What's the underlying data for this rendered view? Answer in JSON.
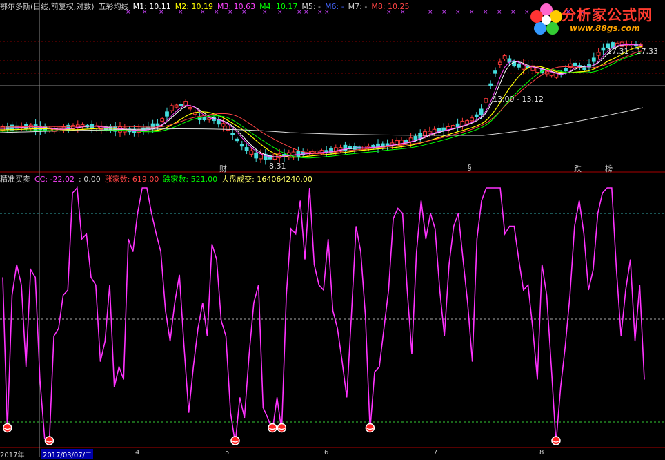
{
  "header": {
    "title": "鄂尔多斯(日线,前复权,对数)",
    "indicator": "五彩均线",
    "ma": [
      {
        "label": "M1: 10.11",
        "color": "#ffffff"
      },
      {
        "label": "M2: 10.19",
        "color": "#ffff00"
      },
      {
        "label": "M3: 10.63",
        "color": "#ff44ff"
      },
      {
        "label": "M4: 10.17",
        "color": "#00ff00"
      },
      {
        "label": "M5: -",
        "color": "#cccccc"
      },
      {
        "label": "M6: -",
        "color": "#4466ff"
      },
      {
        "label": "M7: -",
        "color": "#cccccc"
      },
      {
        "label": "M8: 10.25",
        "color": "#ff4444"
      }
    ]
  },
  "logo": {
    "title": "分析家公式网",
    "url": "www.88gs.com"
  },
  "price_labels": {
    "high": "17.31 - 17.33",
    "mid": "13.00 - 13.12",
    "low": "8.31"
  },
  "events": [
    {
      "text": "财",
      "color": "#66aaff"
    },
    {
      "text": "§",
      "color": "#ff3333"
    },
    {
      "text": "跌",
      "color": "#00ff00"
    },
    {
      "text": "榜",
      "color": "#ffaa00"
    }
  ],
  "sub_header": {
    "name": "精准买卖",
    "cc": "CC: -22.02",
    "zero": ": 0.00",
    "up": "涨家数: 619.00",
    "down": "跌家数: 521.00",
    "vol": "大盘成交: 164064240.00"
  },
  "axis": {
    "start": "2017年",
    "date": "2017/03/07/二",
    "months": [
      "4",
      "5",
      "6",
      "7",
      "8"
    ]
  },
  "chart_data": [
    {
      "type": "line",
      "title": "鄂尔多斯(日线,前复权,对数)",
      "series": [
        {
          "name": "M1",
          "color": "#ffffff"
        },
        {
          "name": "M2",
          "color": "#ffff00"
        },
        {
          "name": "M3",
          "color": "#ff44ff"
        },
        {
          "name": "M4",
          "color": "#00ff00"
        },
        {
          "name": "M8",
          "color": "#ff4444"
        }
      ],
      "annotations": [
        "17.31 - 17.33",
        "13.00 - 13.12",
        "8.31"
      ]
    },
    {
      "type": "line",
      "title": "精准买卖",
      "series": [
        {
          "name": "CC",
          "color": "#ff33ff",
          "values": [
            65,
            5,
            58,
            70,
            62,
            30,
            68,
            65,
            25,
            2,
            0,
            42,
            45,
            58,
            60,
            98,
            100,
            80,
            82,
            65,
            62,
            32,
            40,
            62,
            22,
            30,
            25,
            80,
            75,
            90,
            100,
            100,
            90,
            82,
            75,
            52,
            40,
            55,
            66,
            38,
            12,
            30,
            45,
            55,
            42,
            78,
            72,
            48,
            42,
            12,
            0,
            18,
            10,
            35,
            55,
            62,
            14,
            10,
            5,
            18,
            5,
            58,
            84,
            82,
            95,
            72,
            100,
            70,
            62,
            60,
            80,
            52,
            45,
            32,
            18,
            50,
            85,
            75,
            50,
            5,
            28,
            30,
            45,
            60,
            88,
            92,
            90,
            60,
            35,
            75,
            95,
            80,
            90,
            84,
            60,
            42,
            70,
            85,
            90,
            72,
            55,
            32,
            80,
            95,
            100,
            100,
            100,
            100,
            82,
            85,
            85,
            72,
            60,
            62,
            45,
            25,
            70,
            58,
            30,
            0,
            22,
            38,
            58,
            85,
            95,
            82,
            60,
            68,
            90,
            98,
            100,
            100,
            68,
            42,
            60,
            72,
            40,
            62,
            25
          ]
        }
      ],
      "ylim": [
        0,
        100
      ]
    }
  ]
}
